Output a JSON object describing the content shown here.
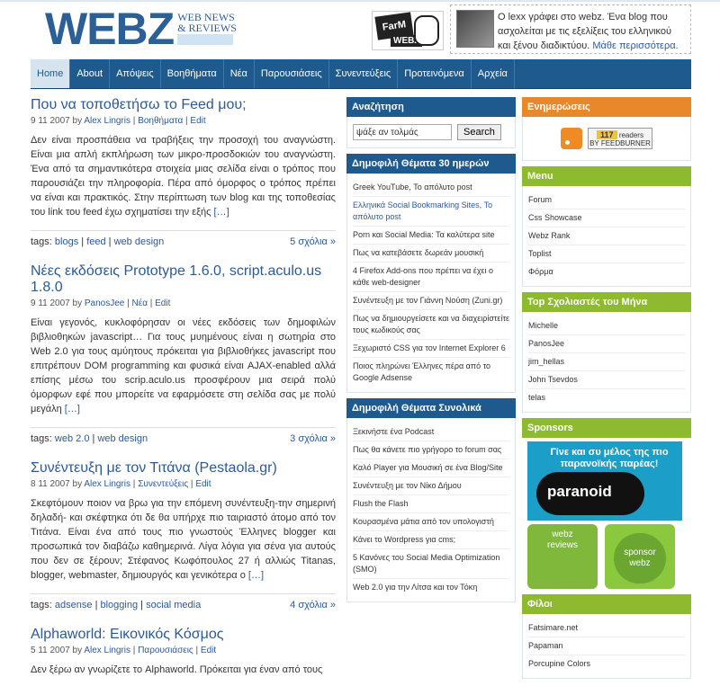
{
  "brand": {
    "name": "WEBZ",
    "line1": "WEB NEWS",
    "line2": "& REVIEWS"
  },
  "badge": {
    "line1": "FarM",
    "line2": "WEBZ"
  },
  "author_box": {
    "text": "Ο lexx γράφει στο webz. Ένα blog που ασχολείται με τις εξελίξεις του ελληνικού και ξένου διαδικτύου.",
    "more": "Μάθε περισσότερα."
  },
  "nav": [
    "Home",
    "About",
    "Απόψεις",
    "Βοηθήματα",
    "Νέα",
    "Παρουσιάσεις",
    "Συνεντεύξεις",
    "Προτεινόμενα",
    "Αρχεία"
  ],
  "posts": [
    {
      "title": "Που να τοποθετήσω το Feed μου;",
      "date": "9 11 2007",
      "by": "by",
      "author": "Alex Lingris",
      "category": "Βοηθήματα",
      "edit": "Edit",
      "excerpt": "Δεν είναι προσπάθεια να τραβήξεις την προσοχή του αναγνώστη. Είναι μια απλή εκπλήρωση των μικρο-προσδοκιών του αναγνώστη. Ένα από τα σημαντικότερα στοιχεία μιας σελίδα είναι ο τρόπος που παρουσιάζει την πληροφορία. Πέρα από όμορφος ο τρόπος πρέπει να είναι και πρακτικός. Στην περίπτωση των blog και της τοποθεσίας του link του feed έχω σχηματίσει την εξής",
      "more": "[…]",
      "tags_label": "tags:",
      "tags": [
        "blogs",
        "feed",
        "web design"
      ],
      "comments": "5 σχόλια »"
    },
    {
      "title": "Νέες εκδόσεις Prototype 1.6.0, script.aculo.us 1.8.0",
      "date": "9 11 2007",
      "by": "by",
      "author": "PanosJee",
      "category": "Νέα",
      "edit": "Edit",
      "excerpt": "Είναι γεγονός, κυκλοφόρησαν οι νέες εκδόσεις των δημοφιλών βιβλιοθηκών javascript… Για τους μυημένους είναι η σωτηρία στο Web 2.0 για τους αμύητους πρόκειται για βιβλιοθήκες javascript που επιτρέπουν DOM programming και φυσικά είναι AJAX-enabled αλλά επίσης μέσω του scrip.aculo.us προσφέρουν μια σειρά πολύ όμορφων εφέ που μπορείτε να εφαρμόσετε στη σελίδα σας με πολύ μεγάλη",
      "more": "[…]",
      "tags_label": "tags:",
      "tags": [
        "web 2.0",
        "web design"
      ],
      "comments": "3 σχόλια »"
    },
    {
      "title": "Συνέντευξη με τον Τιτάνα (Pestaola.gr)",
      "date": "8 11 2007",
      "by": "by",
      "author": "Alex Lingris",
      "category": "Συνεντεύξεις",
      "edit": "Edit",
      "excerpt": "Σκεφτόμουν ποιον να βρω για την επόμενη συνέντευξη-την σημερινή δηλαδή- και σκέφτηκα ότι δε θα υπήρχε πιο ταιριαστό άτομο από τον Τιτάνα. Είναι ένα από τους πιο γνωστούς Έλληνες blogger και προσωπικά τον διαβάζω καθημερινά. Λίγα λόγια για σένα για αυτούς που δεν σε ξέρουν; Στέφανος Κωφόπουλος 27 ή αλλιώς Titanas, blogger, webmaster, δημιουργός και γενικότερα ο",
      "more": "[…]",
      "tags_label": "tags:",
      "tags": [
        "adsense",
        "blogging",
        "social media"
      ],
      "comments": "4 σχόλια »"
    },
    {
      "title": "Alphaworld: Εικονικός Κόσμος",
      "date": "5 11 2007",
      "by": "by",
      "author": "Alex Lingris",
      "category": "Παρουσιάσεις",
      "edit": "Edit",
      "excerpt": "Δεν ξέρω αν γνωρίζετε το Alphaworld. Πρόκειται για έναν από τους",
      "more": "",
      "tags_label": "",
      "tags": [],
      "comments": ""
    }
  ],
  "search": {
    "title": "Αναζήτηση",
    "placeholder": "ψάξε αν τολμάς",
    "button": "Search"
  },
  "popular30": {
    "title": "Δημοφιλή Θέματα 30 ημερών",
    "items": [
      "Greek YouTube, Το απόλυτο post",
      "Ελληνικά Social Bookmarking Sites, Το απόλυτο post",
      "Porn και Social Media: Τα καλύτερα site",
      "Πως να κατεβάσετε δωρεάν μουσική",
      "4 Firefox Add-ons που πρέπει να έχει ο κάθε web-designer",
      "Συνέντευξη με τον Γιάννη Νούση (Zuni.gr)",
      "Πως να δημιουργείσετε και να διαχειρίστείτε τους κωδικούς σας",
      "Ξεχωριστό CSS για τον Internet Explorer 6",
      "Ποιος πληρώνει Έλληνες πέρα από το Google Adsense"
    ]
  },
  "popular_all": {
    "title": "Δημοφιλή Θέματα Συνολικά",
    "items": [
      "Ξεκινήστε ένα Podcast",
      "Πως θα κάνετε πιο γρήγορο το forum σας",
      "Καλό Player για Μουσική σε ένα Blog/Site",
      "Συνέντευξη με τον Νίκο Δήμου",
      "Flush the Flash",
      "Κουρασμένα μάτια από τον υπολογιστή",
      "Κάνει το Wordpress για cms;",
      "5 Κανόνες του Social Media Optimization (SMO)",
      "Web 2.0 για την Λίτσα και τον Τόκη"
    ]
  },
  "updates": {
    "title": "Ενημερώσεις",
    "count": "117",
    "readers": "readers",
    "by": "BY FEEDBURNER"
  },
  "menu": {
    "title": "Menu",
    "items": [
      "Forum",
      "Css Showcase",
      "Webz Rank",
      "Toplist",
      "Φόρμα"
    ]
  },
  "top_commenters": {
    "title": "Top Σχολιαστές του Μήνα",
    "items": [
      "Michelle",
      "PanosJee",
      "jim_hellas",
      "John Tsevdos",
      "telas"
    ]
  },
  "sponsors": {
    "title": "Sponsors",
    "banner_text": "Γίνε και συ μέλος της πιο παρανοϊκής παρέας!",
    "banner_logo": "paranoid",
    "tile1_a": "webz",
    "tile1_b": "reviews",
    "tile2_a": "sponsor",
    "tile2_b": "webz"
  },
  "friends": {
    "title": "Φίλοι",
    "items": [
      "Fatsimare.net",
      "Papaman",
      "Porcupine Colors"
    ]
  }
}
